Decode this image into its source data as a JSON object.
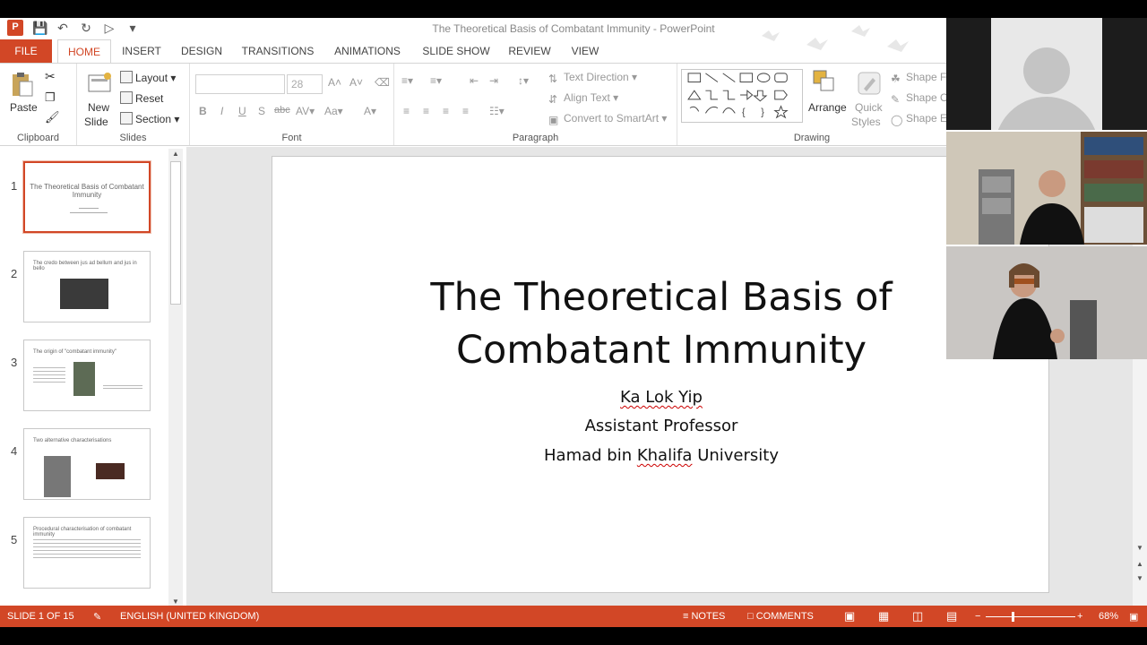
{
  "window": {
    "title": "The Theoretical Basis of Combatant Immunity - PowerPoint",
    "app_icon": "P"
  },
  "tabs": [
    "FILE",
    "HOME",
    "INSERT",
    "DESIGN",
    "TRANSITIONS",
    "ANIMATIONS",
    "SLIDE SHOW",
    "REVIEW",
    "VIEW"
  ],
  "active_tab": "HOME",
  "ribbon": {
    "clipboard": {
      "label": "Clipboard",
      "paste": "Paste"
    },
    "slides": {
      "label": "Slides",
      "new_slide_line1": "New",
      "new_slide_line2": "Slide",
      "layout": "Layout",
      "reset": "Reset",
      "section": "Section"
    },
    "font": {
      "label": "Font",
      "size": "28"
    },
    "paragraph": {
      "label": "Paragraph",
      "text_direction": "Text Direction",
      "align_text": "Align Text",
      "convert_smartart": "Convert to SmartArt"
    },
    "drawing": {
      "label": "Drawing",
      "arrange": "Arrange",
      "quick_styles_1": "Quick",
      "quick_styles_2": "Styles",
      "shape_fill": "Shape Fi",
      "shape_outline": "Shape O",
      "shape_effects": "Shape Ef"
    }
  },
  "slide": {
    "title_line1": "The Theoretical Basis of",
    "title_line2": "Combatant Immunity",
    "author": "Ka Lok Yip",
    "position": "Assistant Professor",
    "institution_part1": "Hamad bin ",
    "institution_part2": "Khalifa",
    "institution_part3": " University"
  },
  "thumbnails": [
    {
      "num": "1",
      "title": "The Theoretical Basis of Combatant Immunity"
    },
    {
      "num": "2",
      "title": "The credo between jus ad bellum and jus in bello"
    },
    {
      "num": "3",
      "title": "The origin of \"combatant immunity\""
    },
    {
      "num": "4",
      "title": "Two alternative characterisations"
    },
    {
      "num": "5",
      "title": "Procedural characterisation of combatant immunity"
    }
  ],
  "statusbar": {
    "slide_info": "SLIDE 1 OF 15",
    "language": "ENGLISH (UNITED KINGDOM)",
    "notes": "NOTES",
    "comments": "COMMENTS",
    "zoom": "68%"
  },
  "colors": {
    "accent": "#d24726"
  }
}
